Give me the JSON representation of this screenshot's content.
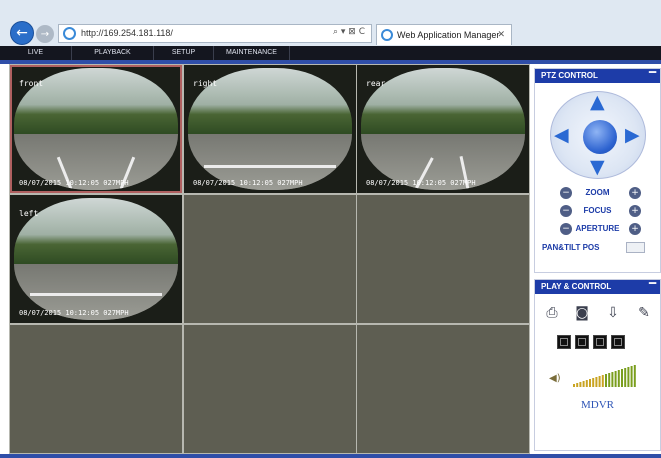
{
  "browser": {
    "url": "http://169.254.181.118/",
    "tab_title": "Web Application Manager",
    "addr_controls": "⌕ ▾ ⊠ C",
    "tab_close": "✕",
    "back_icon": "arrow-left-icon",
    "forward_icon": "arrow-right-icon"
  },
  "menu": {
    "items": [
      "LIVE",
      "PLAYBACK",
      "SETUP",
      "MAINTENANCE"
    ]
  },
  "cameras": [
    {
      "name": "front",
      "timestamp": "08/07/2015 10:12:05  027MPH"
    },
    {
      "name": "right",
      "timestamp": "08/07/2015 10:12:05  027MPH"
    },
    {
      "name": "rear",
      "timestamp": "08/07/2015 10:12:05  027MPH"
    },
    {
      "name": "left",
      "timestamp": "08/07/2015 10:12:05  027MPH"
    }
  ],
  "ptz": {
    "title": "PTZ CONTROL",
    "minimize": "▔",
    "zoom_label": "ZOOM",
    "focus_label": "FOCUS",
    "aperture_label": "APERTURE",
    "minus": "−",
    "plus": "+",
    "pan_tilt_label": "PAN&TILT POS"
  },
  "play_control": {
    "title": "PLAY & CONTROL",
    "minimize": "▔",
    "icons": [
      "record-icon",
      "snapshot-icon",
      "download-icon",
      "settings-pen-icon"
    ],
    "layouts": [
      "1-split",
      "4-split",
      "9-split",
      "16-split"
    ],
    "brand": "MDVR",
    "volume_level": 1.0
  },
  "colors": {
    "accent": "#1d3ca8",
    "menubar": "#14161f",
    "empty_cell": "#5e5e52"
  }
}
